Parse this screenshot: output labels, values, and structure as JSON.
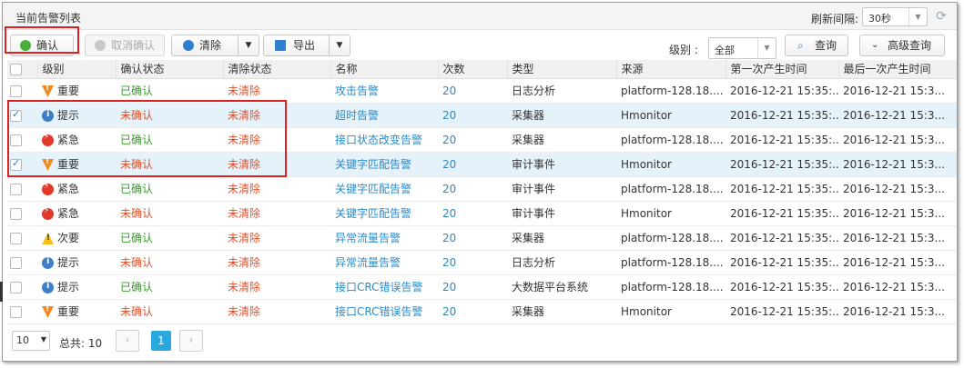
{
  "panel": {
    "title": "当前告警列表",
    "refresh_label": "刷新间隔:",
    "refresh_value": "30秒"
  },
  "toolbar": {
    "confirm": "确认",
    "cancel_confirm": "取消确认",
    "clear": "清除",
    "export": "导出",
    "level_label": "级别 :",
    "level_value": "全部",
    "query": "查询",
    "advanced_query": "高级查询"
  },
  "columns": [
    "级别",
    "确认状态",
    "清除状态",
    "名称",
    "次数",
    "类型",
    "来源",
    "第一次产生时间",
    "最后一次产生时间"
  ],
  "rows": [
    {
      "checked": false,
      "level": "重要",
      "level_icon": "important-icon",
      "confirm": "已确认",
      "clear": "未清除",
      "name": "攻击告警",
      "count": "20",
      "type": "日志分析",
      "source": "platform-128.18....",
      "first": "2016-12-21 15:35:...",
      "last": "2016-12-21 15:3..."
    },
    {
      "checked": true,
      "level": "提示",
      "level_icon": "info-icon",
      "confirm": "未确认",
      "clear": "未清除",
      "name": "超时告警",
      "count": "20",
      "type": "采集器",
      "source": "Hmonitor",
      "first": "2016-12-21 15:35:...",
      "last": "2016-12-21 15:3..."
    },
    {
      "checked": false,
      "level": "紧急",
      "level_icon": "urgent-icon",
      "confirm": "已确认",
      "clear": "未清除",
      "name": "接口状态改变告警",
      "count": "20",
      "type": "采集器",
      "source": "platform-128.18....",
      "first": "2016-12-21 15:35:...",
      "last": "2016-12-21 15:3..."
    },
    {
      "checked": true,
      "level": "重要",
      "level_icon": "important-icon",
      "confirm": "未确认",
      "clear": "未清除",
      "name": "关键字匹配告警",
      "count": "20",
      "type": "审计事件",
      "source": "Hmonitor",
      "first": "2016-12-21 15:35:...",
      "last": "2016-12-21 15:3..."
    },
    {
      "checked": false,
      "level": "紧急",
      "level_icon": "urgent-icon",
      "confirm": "已确认",
      "clear": "未清除",
      "name": "关键字匹配告警",
      "count": "20",
      "type": "审计事件",
      "source": "platform-128.18....",
      "first": "2016-12-21 15:35:...",
      "last": "2016-12-21 15:3..."
    },
    {
      "checked": false,
      "level": "紧急",
      "level_icon": "urgent-icon",
      "confirm": "未确认",
      "clear": "未清除",
      "name": "关键字匹配告警",
      "count": "20",
      "type": "审计事件",
      "source": "Hmonitor",
      "first": "2016-12-21 15:35:...",
      "last": "2016-12-21 15:3..."
    },
    {
      "checked": false,
      "level": "次要",
      "level_icon": "minor-icon",
      "confirm": "已确认",
      "clear": "未清除",
      "name": "异常流量告警",
      "count": "20",
      "type": "采集器",
      "source": "platform-128.18....",
      "first": "2016-12-21 15:35:...",
      "last": "2016-12-21 15:3..."
    },
    {
      "checked": false,
      "level": "提示",
      "level_icon": "info-icon",
      "confirm": "未确认",
      "clear": "未清除",
      "name": "异常流量告警",
      "count": "20",
      "type": "日志分析",
      "source": "platform-128.18....",
      "first": "2016-12-21 15:35:...",
      "last": "2016-12-21 15:3..."
    },
    {
      "checked": false,
      "level": "提示",
      "level_icon": "info-icon",
      "confirm": "已确认",
      "clear": "未清除",
      "name": "接口CRC错误告警",
      "count": "20",
      "type": "大数据平台系统",
      "source": "platform-128.18....",
      "first": "2016-12-21 15:35:...",
      "last": "2016-12-21 15:3..."
    },
    {
      "checked": false,
      "level": "重要",
      "level_icon": "important-icon",
      "confirm": "未确认",
      "clear": "未清除",
      "name": "接口CRC错误告警",
      "count": "20",
      "type": "采集器",
      "source": "Hmonitor",
      "first": "2016-12-21 15:35:...",
      "last": "2016-12-21 15:3..."
    }
  ],
  "pager": {
    "page_size": "10",
    "total_label": "总共:",
    "total_value": "10",
    "current_page": "1",
    "prev": "‹",
    "next": "›"
  },
  "colors": {
    "confirmed": "#3a9a2c",
    "unconfirmed": "#e0502a",
    "link": "#2a8bc9",
    "selected_row": "#e6f2fa",
    "highlight_border": "#e02020",
    "current_page": "#29a7df"
  }
}
